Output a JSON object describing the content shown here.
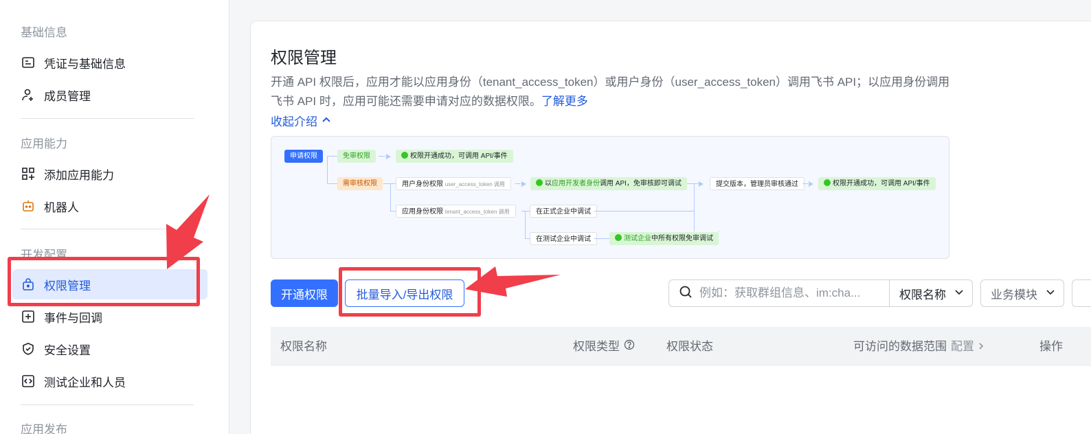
{
  "sidebar": {
    "sections": {
      "basic": "基础信息",
      "ability": "应用能力",
      "dev": "开发配置",
      "publish": "应用发布"
    },
    "items": [
      {
        "label": "凭证与基础信息",
        "icon": "credential-icon"
      },
      {
        "label": "成员管理",
        "icon": "member-icon"
      },
      {
        "label": "添加应用能力",
        "icon": "grid-add-icon"
      },
      {
        "label": "机器人",
        "icon": "robot-icon"
      },
      {
        "label": "权限管理",
        "icon": "lock-icon",
        "active": true
      },
      {
        "label": "事件与回调",
        "icon": "event-icon"
      },
      {
        "label": "安全设置",
        "icon": "shield-icon"
      },
      {
        "label": "测试企业和人员",
        "icon": "code-icon"
      }
    ]
  },
  "main": {
    "title": "权限管理",
    "desc_text": "开通 API 权限后，应用才能以应用身份（tenant_access_token）或用户身份（user_access_token）调用飞书 API；以应用身份调用飞书 API 时，应用可能还需要申请对应的数据权限。",
    "learn_more": "了解更多",
    "collapse_label": "收起介绍",
    "flow": {
      "apply": "申请权限",
      "exempt": "免审权限",
      "exempt_result": "权限开通成功，可调用 API/事件",
      "review": "需审核权限",
      "user_perm": "用户身份权限",
      "user_token": "user_access_token 调用",
      "dev_debug_pre": "以",
      "dev_debug_green": "应用开发者身份",
      "dev_debug_post": "调用 API，免审核即可调试",
      "submit": "提交版本，管理员审核通过",
      "final_result": "权限开通成功，可调用 API/事件",
      "app_perm": "应用身份权限",
      "tenant_token": "tenant_access_token 调用",
      "formal_debug": "在正式企业中调试",
      "test_debug": "在测试企业中调试",
      "test_green": "测试企业",
      "test_post": "中所有权限免审调试"
    },
    "toolbar": {
      "open_button": "开通权限",
      "batch_button": "批量导入/导出权限",
      "search_placeholder": "例如：获取群组信息、im:cha...",
      "filter_name": "权限名称",
      "filter_module": "业务模块"
    },
    "table": {
      "col_name": "权限名称",
      "col_type": "权限类型",
      "col_status": "权限状态",
      "col_scope": "可访问的数据范围",
      "col_scope_config": "配置",
      "col_action": "操作"
    }
  },
  "colors": {
    "accent": "#3370ff",
    "active_bg": "#e1eaff",
    "annotation": "#f03e4a"
  }
}
